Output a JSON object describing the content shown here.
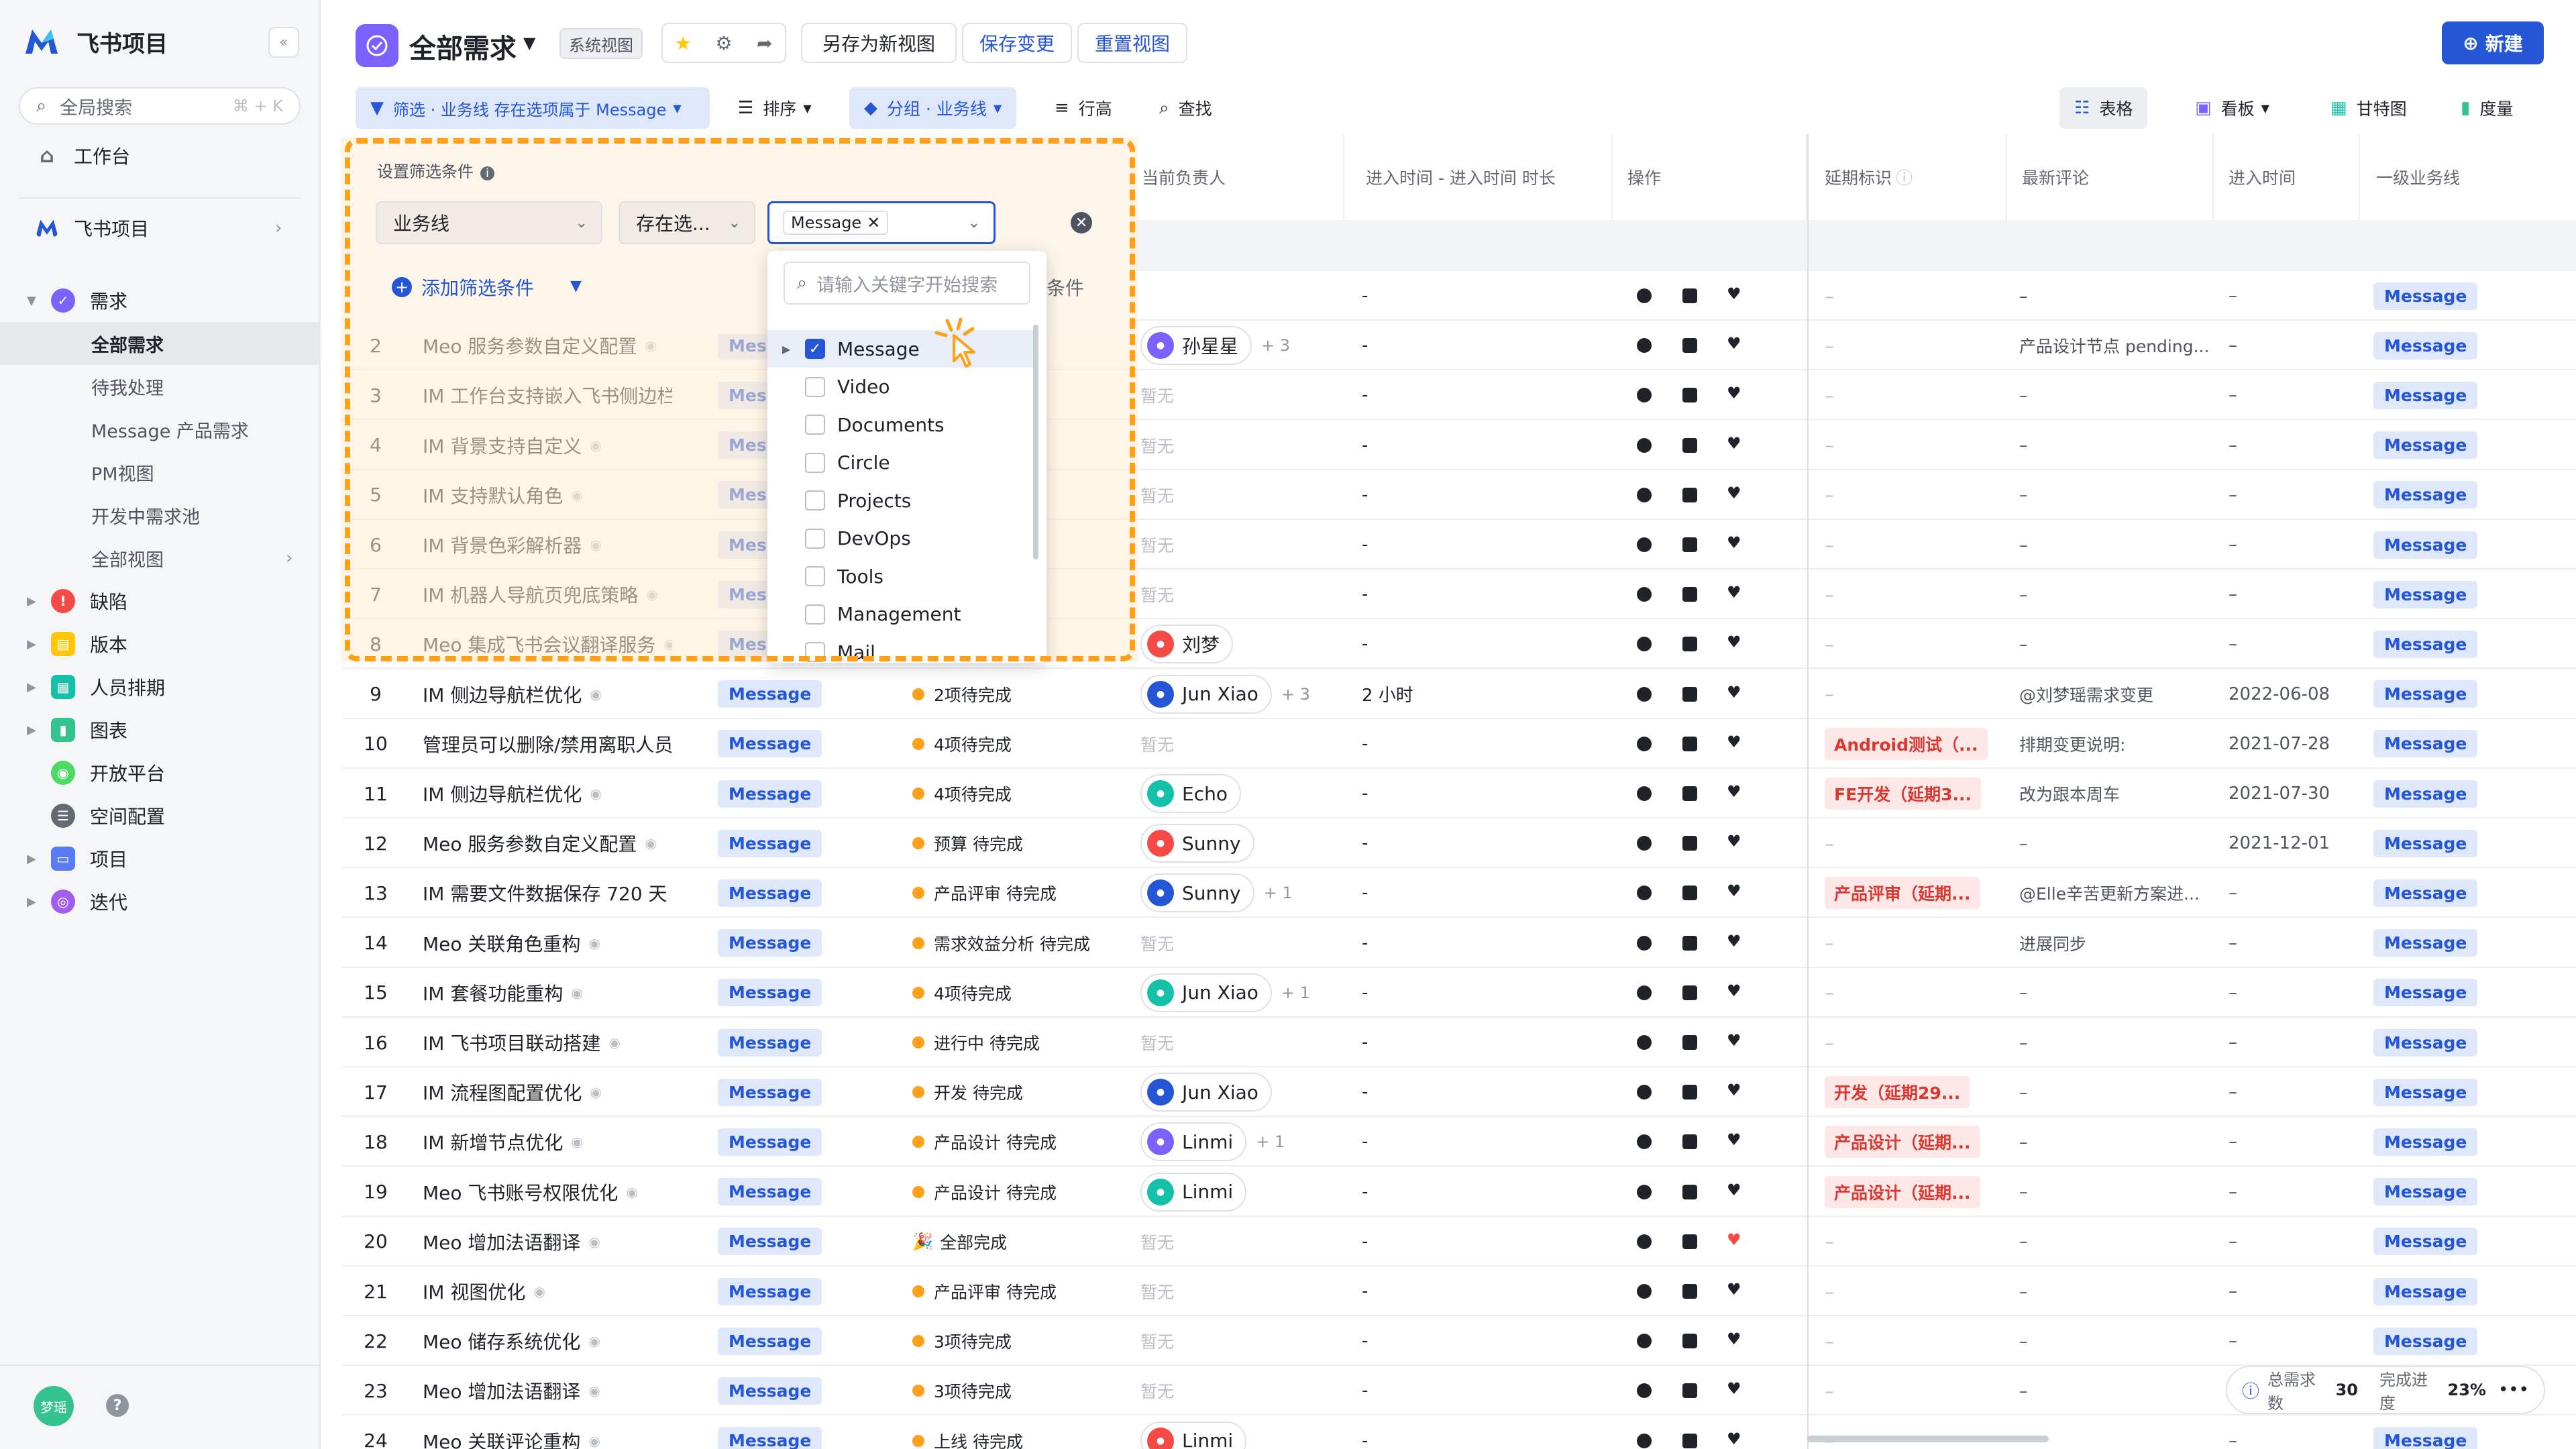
{
  "app": {
    "name": "飞书项目"
  },
  "sidebar": {
    "search": {
      "placeholder": "全局搜索",
      "shortcut": "⌘ + K"
    },
    "workbench": "工作台",
    "project": "飞书项目",
    "sections": [
      {
        "label": "需求",
        "color": "#7b61ff"
      },
      {
        "label": "缺陷",
        "color": "#f54a45"
      },
      {
        "label": "版本",
        "color": "#ffc60a"
      },
      {
        "label": "人员排期",
        "color": "#14c0a7"
      },
      {
        "label": "图表",
        "color": "#34c38f"
      },
      {
        "label": "开放平台",
        "color": "#4cd964"
      },
      {
        "label": "空间配置",
        "color": "#646a73"
      },
      {
        "label": "项目",
        "color": "#5b7bf0"
      },
      {
        "label": "迭代",
        "color": "#a35ef0"
      }
    ],
    "sub_items": [
      "全部需求",
      "待我处理",
      "Message 产品需求",
      "PM视图",
      "开发中需求池",
      "全部视图"
    ],
    "active_sub": "全部需求",
    "user_initials": "梦瑶"
  },
  "header": {
    "title": "全部需求",
    "badge": "系统视图",
    "save_as": "另存为新视图",
    "save_changes": "保存变更",
    "reset_view": "重置视图",
    "new_button": "新建"
  },
  "toolbar": {
    "filter": "筛选 · 业务线 存在选项属于 Message",
    "sort": "排序",
    "group": "分组 · 业务线",
    "row_height": "行高",
    "find": "查找",
    "views": {
      "table": "表格",
      "board": "看板",
      "gantt": "甘特图",
      "measure": "度量"
    }
  },
  "columns": {
    "owner": "当前负责人",
    "duration": "进入时间 - 进入时间 时长",
    "ops": "操作",
    "delay": "延期标识",
    "comment": "最新评论",
    "enter_time": "进入时间",
    "business_line": "一级业务线"
  },
  "filter_popup": {
    "title": "设置筛选条件",
    "field": "业务线",
    "operator": "存在选...",
    "value": "Message",
    "add_condition": "添加筛选条件",
    "partial_text": "条件",
    "search_placeholder": "请输入关键字开始搜索",
    "options": [
      {
        "label": "Message",
        "checked": true
      },
      {
        "label": "Video",
        "checked": false
      },
      {
        "label": "Documents",
        "checked": false
      },
      {
        "label": "Circle",
        "checked": false
      },
      {
        "label": "Projects",
        "checked": false
      },
      {
        "label": "DevOps",
        "checked": false
      },
      {
        "label": "Tools",
        "checked": false
      },
      {
        "label": "Management",
        "checked": false
      },
      {
        "label": "Mail",
        "checked": false
      }
    ]
  },
  "rows": [
    {
      "num": "",
      "title": "",
      "tag": "",
      "status": "",
      "owner": "",
      "owner_extra": "",
      "duration": "-",
      "delay": "–",
      "comment": "–",
      "date": "–",
      "bl": "Message"
    },
    {
      "num": "2",
      "title": "Meo 服务参数自定义配置",
      "tag": "Mes",
      "status": "成",
      "owner": "孙星星",
      "owner_extra": "+ 3",
      "duration": "-",
      "delay": "–",
      "comment": "产品设计节点 pending...",
      "date": "–",
      "bl": "Message"
    },
    {
      "num": "3",
      "title": "IM 工作台支持嵌入飞书侧边栏",
      "tag": "Mes",
      "status": "",
      "owner": "",
      "owner_extra": "",
      "duration": "-",
      "delay": "–",
      "comment": "–",
      "date": "–",
      "bl": "Message"
    },
    {
      "num": "4",
      "title": "IM 背景支持自定义",
      "tag": "Mes",
      "status": "",
      "owner": "",
      "owner_extra": "",
      "duration": "-",
      "delay": "–",
      "comment": "–",
      "date": "–",
      "bl": "Message"
    },
    {
      "num": "5",
      "title": "IM 支持默认角色",
      "tag": "Mes",
      "status": "",
      "owner": "",
      "owner_extra": "",
      "duration": "-",
      "delay": "–",
      "comment": "–",
      "date": "–",
      "bl": "Message"
    },
    {
      "num": "6",
      "title": "IM 背景色彩解析器",
      "tag": "Mes",
      "status": "",
      "owner": "",
      "owner_extra": "",
      "duration": "-",
      "delay": "–",
      "comment": "–",
      "date": "–",
      "bl": "Message"
    },
    {
      "num": "7",
      "title": "IM 机器人导航页兜底策略",
      "tag": "Mes",
      "status": "",
      "owner": "",
      "owner_extra": "",
      "duration": "-",
      "delay": "–",
      "comment": "–",
      "date": "–",
      "bl": "Message"
    },
    {
      "num": "8",
      "title": "Meo 集成飞书会议翻译服务",
      "tag": "Mes",
      "status": "成",
      "owner": "刘梦",
      "owner_extra": "",
      "duration": "-",
      "delay": "–",
      "comment": "–",
      "date": "–",
      "bl": "Message"
    },
    {
      "num": "9",
      "title": "IM 侧边导航栏优化",
      "tag": "Message",
      "status": "2项待完成",
      "owner": "Jun Xiao",
      "owner_extra": "+ 3",
      "duration": "2 小时",
      "delay": "–",
      "comment": "@刘梦瑶需求变更",
      "date": "2022-06-08",
      "bl": "Message"
    },
    {
      "num": "10",
      "title": "管理员可以删除/禁用离职人员",
      "tag": "Message",
      "status": "4项待完成",
      "owner": "",
      "owner_extra": "",
      "duration": "-",
      "delay": "Android测试（...",
      "comment": "排期变更说明:",
      "date": "2021-07-28",
      "bl": "Message"
    },
    {
      "num": "11",
      "title": "IM 侧边导航栏优化",
      "tag": "Message",
      "status": "4项待完成",
      "owner": "Echo",
      "owner_extra": "",
      "duration": "-",
      "delay": "FE开发（延期3...",
      "comment": "改为跟本周车",
      "date": "2021-07-30",
      "bl": "Message"
    },
    {
      "num": "12",
      "title": "Meo 服务参数自定义配置",
      "tag": "Message",
      "status": "预算 待完成",
      "owner": "Sunny",
      "owner_extra": "",
      "duration": "-",
      "delay": "–",
      "comment": "–",
      "date": "2021-12-01",
      "bl": "Message"
    },
    {
      "num": "13",
      "title": "IM 需要文件数据保存 720 天",
      "tag": "Message",
      "status": "产品评审 待完成",
      "owner": "Sunny",
      "owner_extra": "+ 1",
      "duration": "-",
      "delay": "产品评审（延期...",
      "comment": "@Elle辛苦更新方案进...",
      "date": "–",
      "bl": "Message"
    },
    {
      "num": "14",
      "title": "Meo 关联角色重构",
      "tag": "Message",
      "status": "需求效益分析 待完成",
      "owner": "",
      "owner_extra": "",
      "duration": "-",
      "delay": "–",
      "comment": "进展同步",
      "date": "–",
      "bl": "Message"
    },
    {
      "num": "15",
      "title": "IM 套餐功能重构",
      "tag": "Message",
      "status": "4项待完成",
      "owner": "Jun Xiao",
      "owner_extra": "+ 1",
      "duration": "-",
      "delay": "–",
      "comment": "–",
      "date": "–",
      "bl": "Message"
    },
    {
      "num": "16",
      "title": "IM 飞书项目联动搭建",
      "tag": "Message",
      "status": "进行中 待完成",
      "owner": "",
      "owner_extra": "",
      "duration": "-",
      "delay": "–",
      "comment": "–",
      "date": "–",
      "bl": "Message"
    },
    {
      "num": "17",
      "title": "IM 流程图配置优化",
      "tag": "Message",
      "status": "开发 待完成",
      "owner": "Jun Xiao",
      "owner_extra": "",
      "duration": "-",
      "delay": "开发（延期29...",
      "comment": "–",
      "date": "–",
      "bl": "Message"
    },
    {
      "num": "18",
      "title": "IM 新增节点优化",
      "tag": "Message",
      "status": "产品设计 待完成",
      "owner": "Linmi",
      "owner_extra": "+ 1",
      "duration": "-",
      "delay": "产品设计（延期...",
      "comment": "–",
      "date": "–",
      "bl": "Message"
    },
    {
      "num": "19",
      "title": "Meo 飞书账号权限优化",
      "tag": "Message",
      "status": "产品设计 待完成",
      "owner": "Linmi",
      "owner_extra": "",
      "duration": "-",
      "delay": "产品设计（延期...",
      "comment": "–",
      "date": "–",
      "bl": "Message"
    },
    {
      "num": "20",
      "title": "Meo 增加法语翻译",
      "tag": "Message",
      "status": "全部完成",
      "owner": "",
      "owner_extra": "",
      "duration": "-",
      "delay": "–",
      "comment": "–",
      "date": "–",
      "bl": "Message"
    },
    {
      "num": "21",
      "title": "IM 视图优化",
      "tag": "Message",
      "status": "产品评审 待完成",
      "owner": "",
      "owner_extra": "",
      "duration": "-",
      "delay": "–",
      "comment": "–",
      "date": "–",
      "bl": "Message"
    },
    {
      "num": "22",
      "title": "Meo 储存系统优化",
      "tag": "Message",
      "status": "3项待完成",
      "owner": "",
      "owner_extra": "",
      "duration": "-",
      "delay": "–",
      "comment": "–",
      "date": "–",
      "bl": "Message"
    },
    {
      "num": "23",
      "title": "Meo 增加法语翻译",
      "tag": "Message",
      "status": "3项待完成",
      "owner": "",
      "owner_extra": "",
      "duration": "-",
      "delay": "–",
      "comment": "–",
      "date": "–",
      "bl": "Message"
    },
    {
      "num": "24",
      "title": "Meo 关联评论重构",
      "tag": "Message",
      "status": "上线 待完成",
      "owner": "Linmi",
      "owner_extra": "",
      "duration": "-",
      "delay": "–",
      "comment": "–",
      "date": "–",
      "bl": "Message"
    }
  ],
  "empty_owner": "暂无",
  "summary": {
    "total_label": "总需求数",
    "total": "30",
    "progress_label": "完成进度",
    "progress": "23%"
  }
}
